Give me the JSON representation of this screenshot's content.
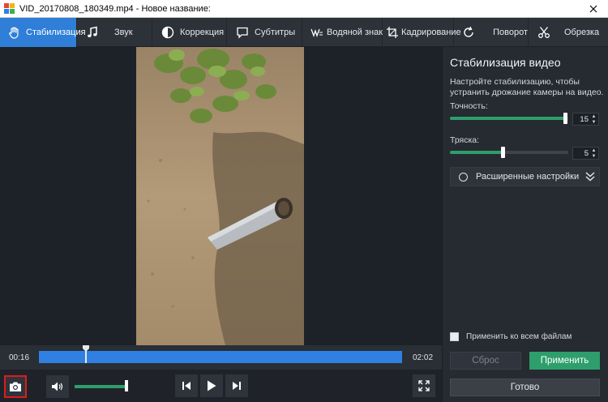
{
  "window": {
    "title": "VID_20170808_180349.mp4 - Новое название:",
    "icon": "app-logo-icon",
    "close_icon": "close-icon"
  },
  "tabs": [
    {
      "label": "Стабилизация",
      "icon": "hand-icon",
      "active": true
    },
    {
      "label": "Звук",
      "icon": "music-note-icon",
      "active": false
    },
    {
      "label": "Коррекция",
      "icon": "contrast-icon",
      "active": false
    },
    {
      "label": "Субтитры",
      "icon": "speech-bubble-icon",
      "active": false
    },
    {
      "label": "Водяной знак",
      "icon": "watermark-icon",
      "active": false
    },
    {
      "label": "Кадрирование",
      "icon": "crop-icon",
      "active": false
    },
    {
      "label": "Поворот",
      "icon": "rotate-icon",
      "active": false
    },
    {
      "label": "Обрезка",
      "icon": "scissors-icon",
      "active": false
    }
  ],
  "panel": {
    "title": "Стабилизация видео",
    "description": "Настройте стабилизацию, чтобы устранить дрожание камеры на видео.",
    "accuracy": {
      "label": "Точность:",
      "value": "15",
      "fraction": 0.98
    },
    "shake": {
      "label": "Тряска:",
      "value": "5",
      "fraction": 0.45
    },
    "advanced_label": "Расширенные настройки",
    "apply_all_label": "Применить ко всем файлам",
    "reset_label": "Сброс",
    "apply_label": "Применить",
    "done_label": "Готово"
  },
  "timeline": {
    "current_time": "00:16",
    "total_time": "02:02",
    "position_fraction": 0.13
  },
  "controls": {
    "snapshot_icon": "camera-icon",
    "volume_icon": "speaker-icon",
    "volume_fraction": 1.0,
    "prev_icon": "skip-back-icon",
    "play_icon": "play-icon",
    "next_icon": "skip-forward-icon",
    "fullscreen_icon": "fullscreen-icon"
  },
  "colors": {
    "accent_blue": "#2f7ed8",
    "accent_green": "#2e9e6c",
    "snapshot_highlight": "#e01a1a"
  }
}
